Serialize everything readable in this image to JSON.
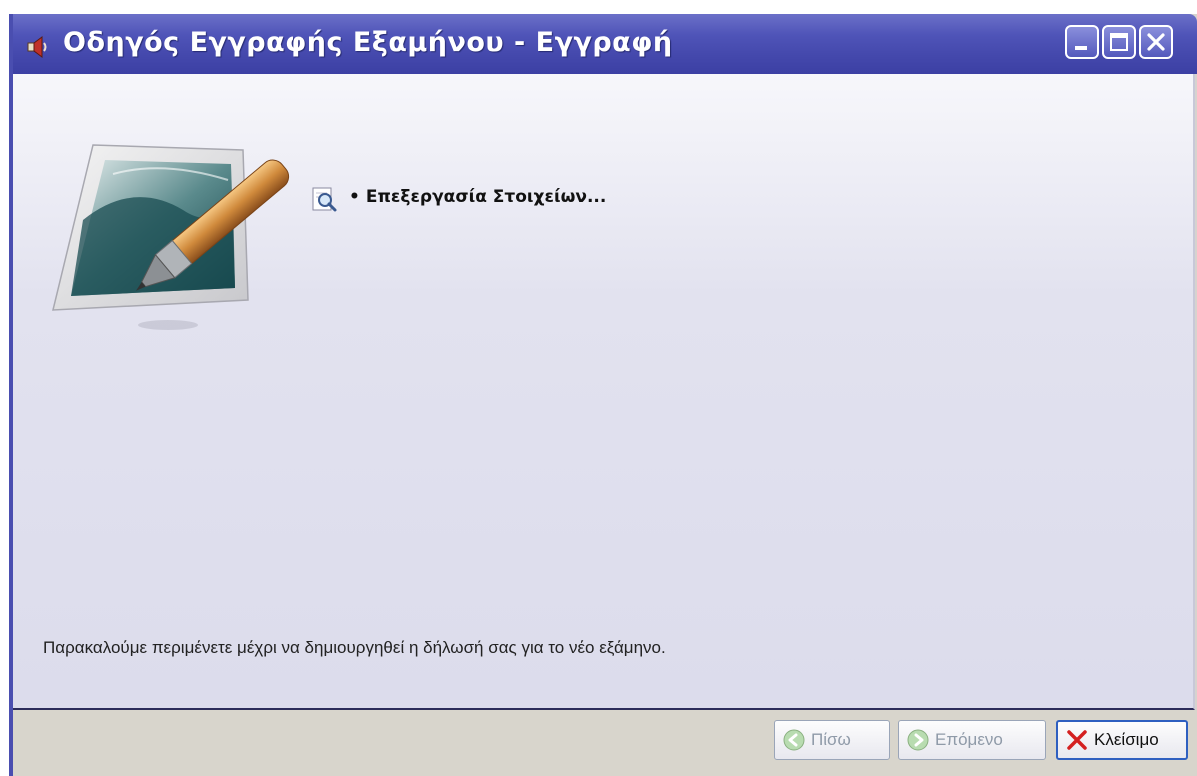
{
  "window": {
    "title": "Οδηγός Εγγραφής Εξαμήνου - Εγγραφή",
    "title_bar_color": "#4f54b8"
  },
  "icons": {
    "app": "speaker-icon",
    "minimize": "minimize-icon",
    "maximize": "maximize-icon",
    "close": "close-icon",
    "wizard": "edit-document-pen-image",
    "status": "magnifier-document-icon",
    "back": "green-left-arrow-icon",
    "next": "green-right-arrow-icon",
    "cancel": "red-x-icon"
  },
  "content": {
    "bullet": "•",
    "status_text": "Επεξεργασία Στοιχείων...",
    "message": "Παρακαλούμε περιμένετε μέχρι να δημιουργηθεί η δήλωσή σας για το νέο εξάμηνο."
  },
  "footer": {
    "back_label": "Πίσω",
    "next_label": "Επόμενο",
    "close_label": "Κλείσιμο",
    "back_enabled": false,
    "next_enabled": false
  }
}
